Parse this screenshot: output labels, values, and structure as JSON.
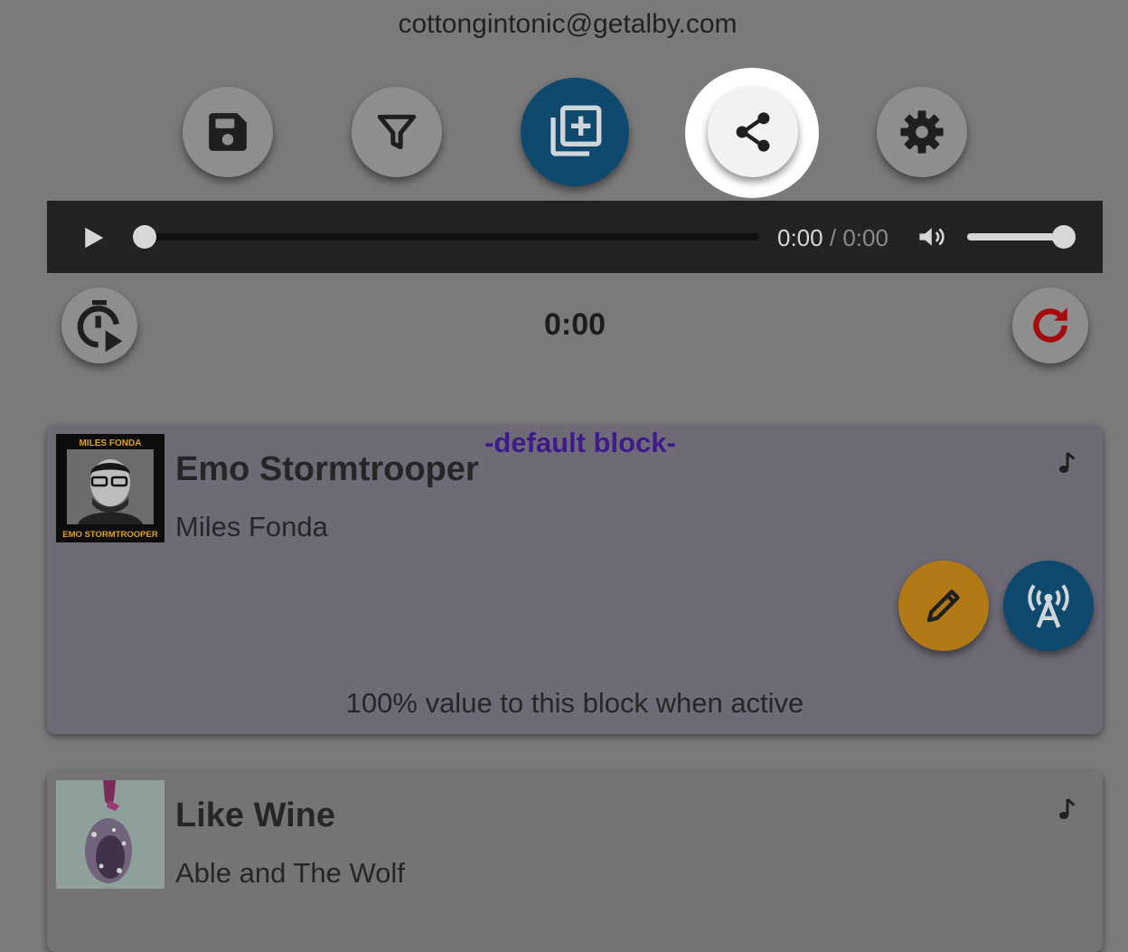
{
  "header": {
    "email": "cottongintonic@getalby.com"
  },
  "toolbar": {
    "buttons": [
      {
        "name": "save",
        "icon": "save-icon"
      },
      {
        "name": "filter",
        "icon": "filter-icon"
      },
      {
        "name": "add-block",
        "icon": "add-library-icon"
      },
      {
        "name": "share",
        "icon": "share-icon",
        "highlighted": true
      },
      {
        "name": "settings",
        "icon": "gear-icon"
      }
    ]
  },
  "player": {
    "current_time": "0:00",
    "separator": "/",
    "duration": "0:00",
    "progress": 0,
    "volume": 1.0
  },
  "timer": {
    "display": "0:00"
  },
  "colors": {
    "background": "#7a7a7a",
    "accent_blue": "#0f4a6e",
    "edit_orange": "#b27a16",
    "default_block_label": "#3f1a8a",
    "refresh_red": "#a50b0b"
  },
  "blocks": [
    {
      "title": "Emo Stormtrooper",
      "artist": "Miles Fonda",
      "tag": "-default block-",
      "value_text": "100% value to this block when active",
      "art_top_text": "MILES FONDA",
      "art_bottom_text": "EMO STORMTROOPER"
    },
    {
      "title": "Like Wine",
      "artist": "Able and The Wolf"
    }
  ]
}
